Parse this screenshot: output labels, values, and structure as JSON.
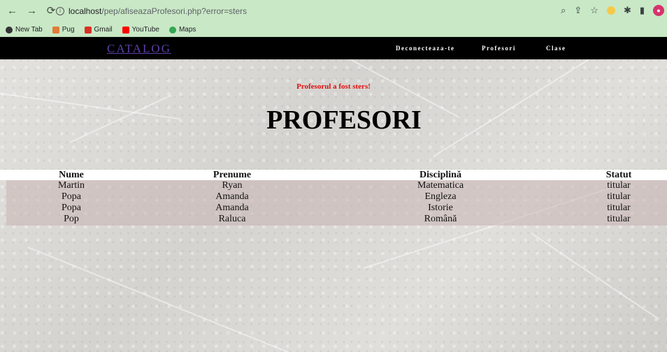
{
  "browser": {
    "url_host": "localhost",
    "url_path": "/pep/afiseazaProfesori.php?error=sters",
    "bookmarks": [
      "New Tab",
      "Pug",
      "Gmail",
      "YouTube",
      "Maps"
    ]
  },
  "nav": {
    "brand": "CATALOG",
    "items": [
      "Deconecteaza-te",
      "Profesori",
      "Clase"
    ]
  },
  "message": "Profesorul a fost sters!",
  "title": "PROFESORI",
  "table": {
    "headers": [
      "Nume",
      "Prenume",
      "Disciplină",
      "Statut"
    ],
    "rows": [
      [
        "Martin",
        "Ryan",
        "Matematica",
        "titular"
      ],
      [
        "Popa",
        "Amanda",
        "Engleza",
        "titular"
      ],
      [
        "Popa",
        "Amanda",
        "Istorie",
        "titular"
      ],
      [
        "Pop",
        "Raluca",
        "Română",
        "titular"
      ]
    ]
  },
  "colors": {
    "message": "#e01010",
    "brand": "#5a3fa8",
    "navbar": "#000000",
    "chrome": "#c9e8c6"
  }
}
